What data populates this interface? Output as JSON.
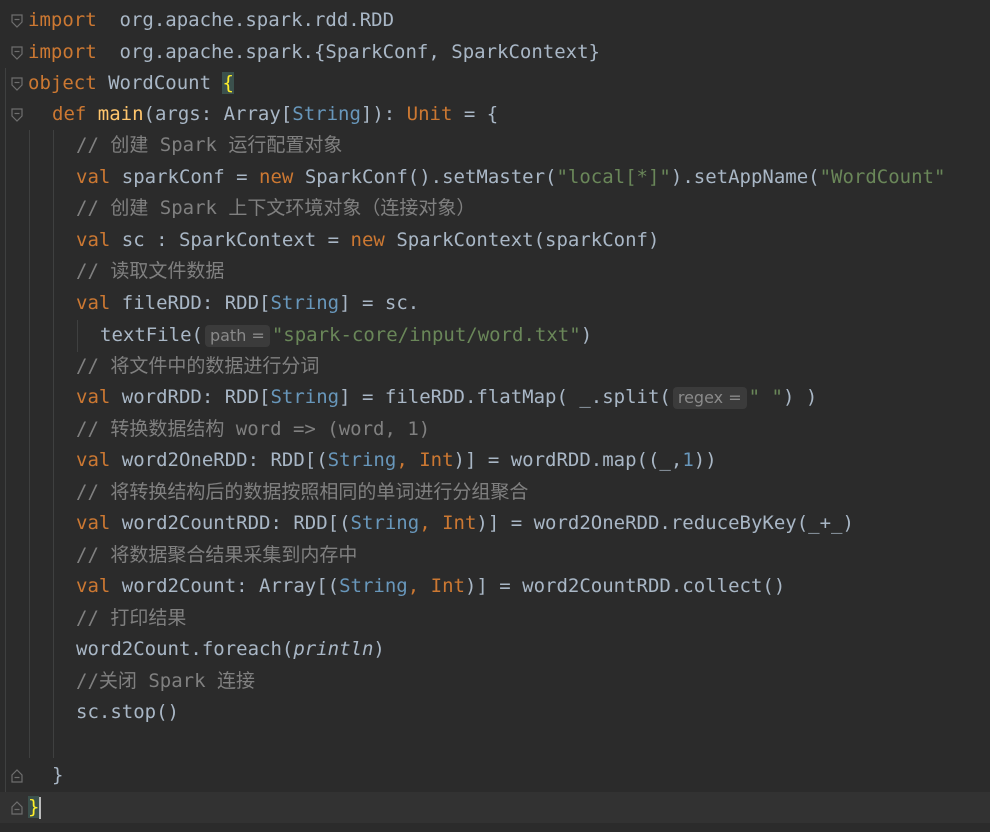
{
  "editor": {
    "lines": [
      {
        "id": "l1",
        "parts": [
          [
            "kw",
            "import"
          ],
          [
            "",
            "  org.apache.spark.rdd.RDD"
          ]
        ]
      },
      {
        "id": "l2",
        "parts": [
          [
            "kw",
            "import"
          ],
          [
            "",
            "  org.apache.spark.{SparkConf, SparkContext}"
          ]
        ]
      },
      {
        "id": "l3",
        "parts": [
          [
            "kw",
            "object"
          ],
          [
            "",
            " WordCount "
          ],
          [
            "brace",
            "{"
          ]
        ]
      },
      {
        "id": "l4",
        "parts": [
          [
            "kw",
            "def "
          ],
          [
            "fn",
            "main"
          ],
          [
            "",
            "(args: Array["
          ],
          [
            "tp",
            "String"
          ],
          [
            "",
            "]): "
          ],
          [
            "kw",
            "Unit"
          ],
          [
            "",
            " = {"
          ]
        ]
      },
      {
        "id": "l5",
        "parts": [
          [
            "cm",
            "// 创建 Spark 运行配置对象"
          ]
        ]
      },
      {
        "id": "l6",
        "parts": [
          [
            "kw",
            "val"
          ],
          [
            "",
            " sparkConf = "
          ],
          [
            "kw",
            "new"
          ],
          [
            "",
            " SparkConf().setMaster("
          ],
          [
            "str",
            "\"local[*]\""
          ],
          [
            "",
            ").setAppName("
          ],
          [
            "str",
            "\"WordCount\""
          ]
        ]
      },
      {
        "id": "l7",
        "parts": [
          [
            "cm",
            "// 创建 Spark 上下文环境对象（连接对象）"
          ]
        ]
      },
      {
        "id": "l8",
        "parts": [
          [
            "kw",
            "val"
          ],
          [
            "",
            " sc : SparkContext = "
          ],
          [
            "kw",
            "new"
          ],
          [
            "",
            " SparkContext(sparkConf)"
          ]
        ]
      },
      {
        "id": "l9",
        "parts": [
          [
            "cm",
            "// 读取文件数据"
          ]
        ]
      },
      {
        "id": "l10",
        "parts": [
          [
            "kw",
            "val"
          ],
          [
            "",
            " fileRDD: RDD["
          ],
          [
            "tp",
            "String"
          ],
          [
            "",
            "] = sc."
          ]
        ]
      },
      {
        "id": "l11",
        "parts": [
          [
            "",
            "textFile("
          ],
          [
            "hint",
            "path ="
          ],
          [
            "str",
            "\"spark-core/input/word.txt\""
          ],
          [
            "",
            ")"
          ]
        ]
      },
      {
        "id": "l12",
        "parts": [
          [
            "cm",
            "// 将文件中的数据进行分词"
          ]
        ]
      },
      {
        "id": "l13",
        "parts": [
          [
            "kw",
            "val"
          ],
          [
            "",
            " wordRDD: RDD["
          ],
          [
            "tp",
            "String"
          ],
          [
            "",
            "] = fileRDD.flatMap( _.split("
          ],
          [
            "hint",
            "regex ="
          ],
          [
            "str",
            "\" \""
          ],
          [
            "",
            ") )"
          ]
        ]
      },
      {
        "id": "l14",
        "parts": [
          [
            "cm",
            "// 转换数据结构 word => (word, 1)"
          ]
        ]
      },
      {
        "id": "l15",
        "parts": [
          [
            "kw",
            "val"
          ],
          [
            "",
            " word2OneRDD: RDD[("
          ],
          [
            "tp",
            "String"
          ],
          [
            "kw",
            ", "
          ],
          [
            "kw",
            "Int"
          ],
          [
            "",
            ")] = wordRDD.map((_,"
          ],
          [
            "num",
            "1"
          ],
          [
            "",
            "))"
          ]
        ]
      },
      {
        "id": "l16",
        "parts": [
          [
            "cm",
            "// 将转换结构后的数据按照相同的单词进行分组聚合"
          ]
        ]
      },
      {
        "id": "l17",
        "parts": [
          [
            "kw",
            "val"
          ],
          [
            "",
            " word2CountRDD: RDD[("
          ],
          [
            "tp",
            "String"
          ],
          [
            "kw",
            ", "
          ],
          [
            "kw",
            "Int"
          ],
          [
            "",
            ")] = word2OneRDD.reduceByKey(_+_)"
          ]
        ]
      },
      {
        "id": "l18",
        "parts": [
          [
            "cm",
            "// 将数据聚合结果采集到内存中"
          ]
        ]
      },
      {
        "id": "l19",
        "parts": [
          [
            "kw",
            "val"
          ],
          [
            "",
            " word2Count: Array[("
          ],
          [
            "tp",
            "String"
          ],
          [
            "kw",
            ", "
          ],
          [
            "kw",
            "Int"
          ],
          [
            "",
            ")] = word2CountRDD.collect()"
          ]
        ]
      },
      {
        "id": "l20",
        "parts": [
          [
            "cm",
            "// 打印结果"
          ]
        ]
      },
      {
        "id": "l21",
        "parts": [
          [
            "",
            "word2Count.foreach("
          ],
          [
            "it",
            "println"
          ],
          [
            "",
            ")"
          ]
        ]
      },
      {
        "id": "l22",
        "parts": [
          [
            "cm",
            "//关闭 Spark 连接"
          ]
        ]
      },
      {
        "id": "l23",
        "parts": [
          [
            "",
            "sc.stop()"
          ]
        ]
      },
      {
        "id": "l24",
        "parts": []
      },
      {
        "id": "l25",
        "parts": [
          [
            "",
            "}"
          ]
        ]
      },
      {
        "id": "l26",
        "parts": [
          [
            "brace",
            "}"
          ]
        ]
      }
    ]
  },
  "colors": {
    "background": "#2b2b2b",
    "keyword": "#cc7832",
    "function": "#ffc66d",
    "string": "#6a8759",
    "comment": "#808080",
    "type": "#6897bb"
  }
}
